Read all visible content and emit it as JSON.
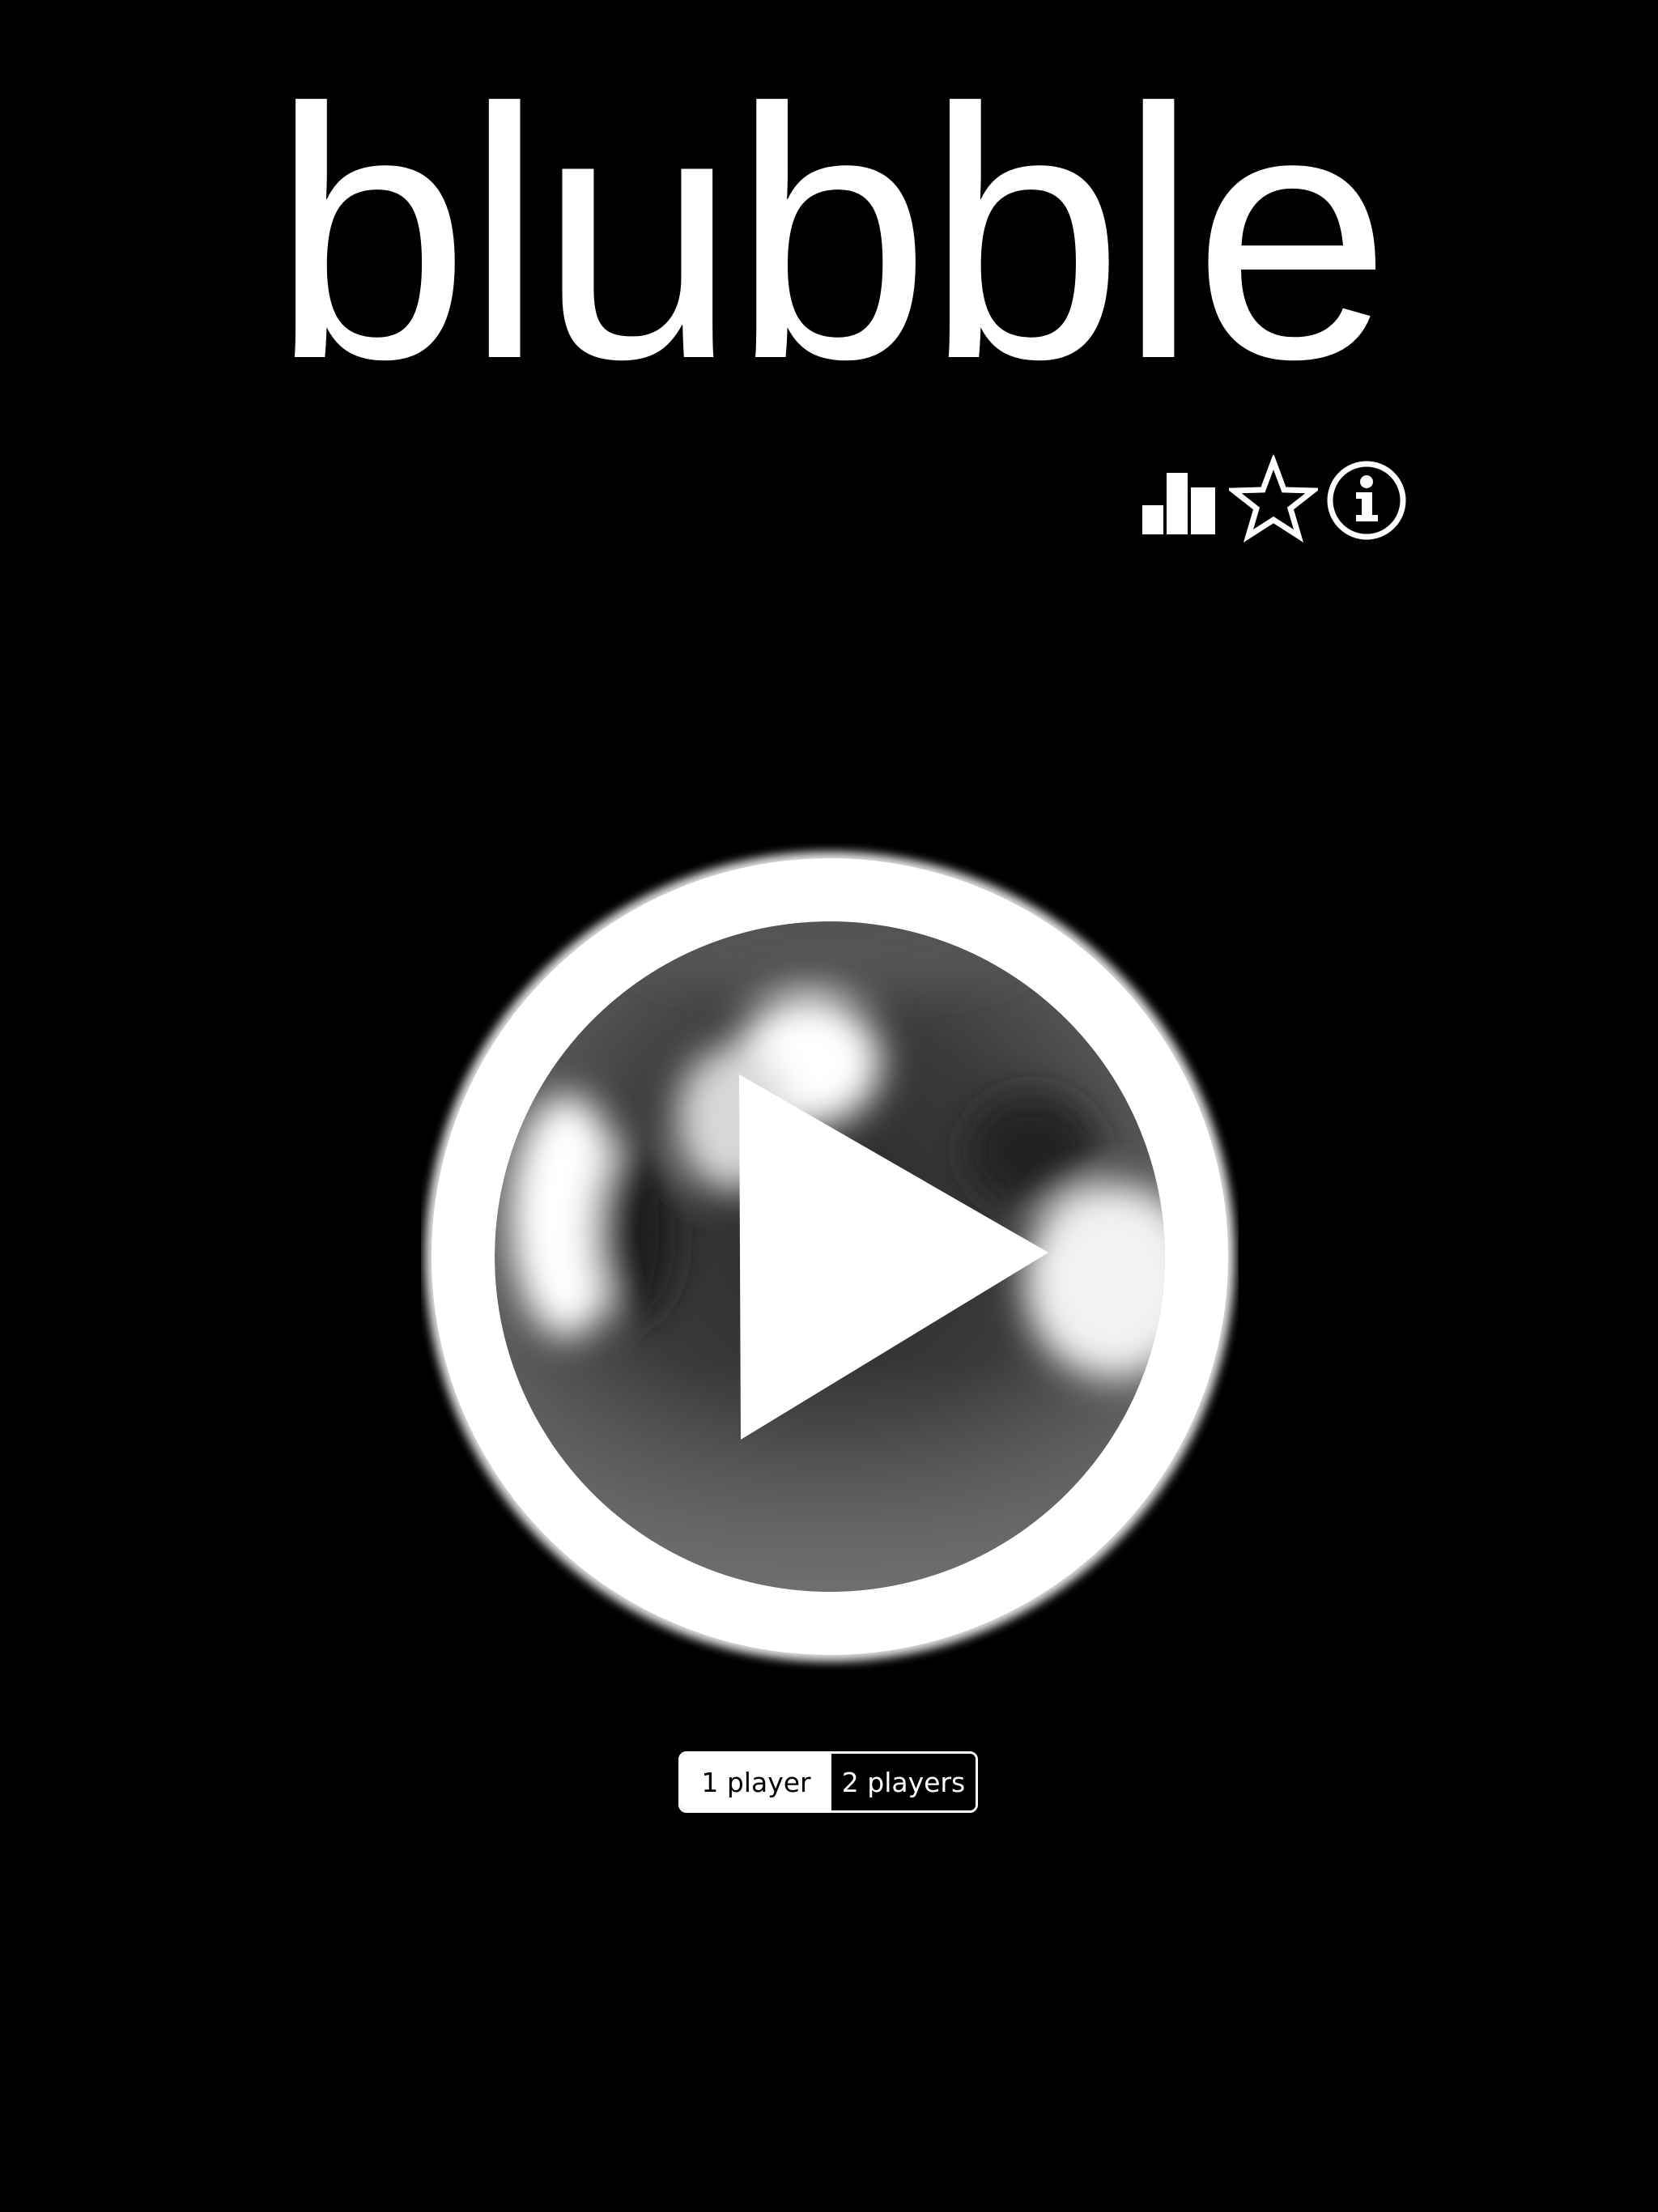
{
  "app": {
    "title": "blubble"
  },
  "toolbar": {
    "icons": [
      "leaderboard-icon",
      "star-icon",
      "info-icon"
    ]
  },
  "play": {
    "icon": "play-icon"
  },
  "mode_selector": {
    "options": [
      {
        "label": "1 player",
        "selected": true
      },
      {
        "label": "2 players",
        "selected": false
      }
    ]
  },
  "colors": {
    "background": "#000000",
    "foreground": "#ffffff"
  }
}
